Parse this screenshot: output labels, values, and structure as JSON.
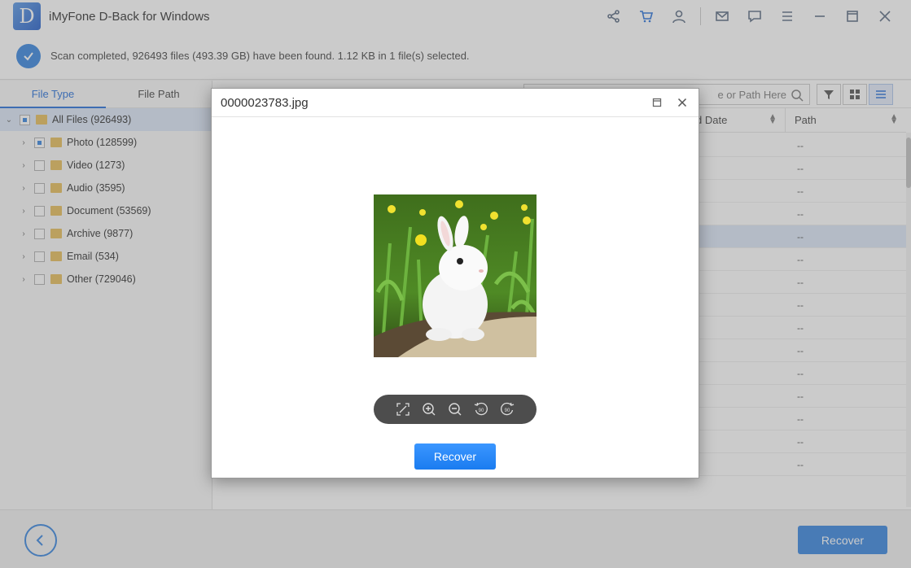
{
  "app": {
    "logo_letter": "D",
    "title": "iMyFone D-Back for Windows"
  },
  "title_icons": [
    "share-icon",
    "cart-icon",
    "user-icon",
    "mail-icon",
    "feedback-icon",
    "menu-icon",
    "minimize-icon",
    "maximize-icon",
    "close-icon"
  ],
  "status": {
    "text": "Scan completed, 926493 files (493.39 GB) have been found. 1.12 KB in 1 file(s) selected."
  },
  "left_tabs": [
    {
      "label": "File Type",
      "active": true
    },
    {
      "label": "File Path",
      "active": false
    }
  ],
  "tree": {
    "root": {
      "label": "All Files (926493)"
    },
    "items": [
      {
        "label": "Photo (128599)",
        "state": "partial"
      },
      {
        "label": "Video (1273)",
        "state": "unchecked"
      },
      {
        "label": "Audio (3595)",
        "state": "unchecked"
      },
      {
        "label": "Document (53569)",
        "state": "unchecked"
      },
      {
        "label": "Archive (9877)",
        "state": "unchecked"
      },
      {
        "label": "Email (534)",
        "state": "unchecked"
      },
      {
        "label": "Other (729046)",
        "state": "unchecked"
      }
    ]
  },
  "search": {
    "visible_text": "e or Path Here"
  },
  "columns": {
    "date": "d Date",
    "path": "Path"
  },
  "rows": [
    "--",
    "--",
    "--",
    "--",
    "--",
    "--",
    "--",
    "--",
    "--",
    "--",
    "--",
    "--",
    "--",
    "--",
    "--"
  ],
  "selected_row": 4,
  "dialog": {
    "title": "0000023783.jpg",
    "recover_label": "Recover",
    "controls": [
      "fullscreen-icon",
      "zoom-in-icon",
      "zoom-out-icon",
      "rotate-left-icon",
      "rotate-right-icon"
    ],
    "rotate_left_text": "90",
    "rotate_right_text": "90"
  },
  "bottom": {
    "recover_label": "Recover"
  },
  "colors": {
    "accent": "#4a90e2",
    "dialog_button": "#1a7cf0",
    "selection": "#dfe9f8"
  }
}
